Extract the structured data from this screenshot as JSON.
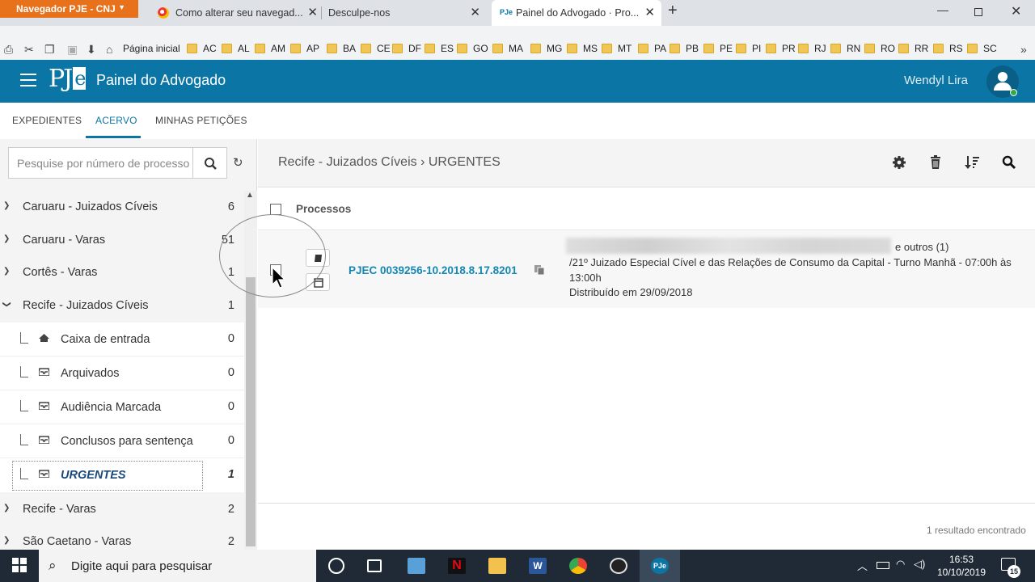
{
  "browser": {
    "app_menu": "Navegador PJE - CNJ",
    "tabs": [
      {
        "label": "Como alterar seu navegad..."
      },
      {
        "label": "Desculpe-nos"
      },
      {
        "label": "Painel do Advogado · Pro..."
      }
    ],
    "home_label": "Página inicial",
    "bookmarks": [
      "AC",
      "AL",
      "AM",
      "AP",
      "BA",
      "CE",
      "DF",
      "ES",
      "GO",
      "MA",
      "MG",
      "MS",
      "MT",
      "PA",
      "PB",
      "PE",
      "PI",
      "PR",
      "RJ",
      "RN",
      "RO",
      "RR",
      "RS",
      "SC"
    ]
  },
  "header": {
    "logo": "PJ",
    "logo_e": "e",
    "title": "Painel do Advogado",
    "user": "Wendyl Lira"
  },
  "nav": {
    "tabs": [
      "EXPEDIENTES",
      "ACERVO",
      "MINHAS PETIÇÕES"
    ],
    "active": "ACERVO"
  },
  "search": {
    "placeholder": "Pesquise por número de processo"
  },
  "tree": {
    "items": [
      {
        "label": "Caruaru - Juizados Cíveis",
        "count": "6"
      },
      {
        "label": "Caruaru - Varas",
        "count": "51"
      },
      {
        "label": "Cortês - Varas",
        "count": "1"
      },
      {
        "label": "Recife - Juizados Cíveis",
        "count": "1"
      },
      {
        "label": "Recife - Varas",
        "count": "2"
      },
      {
        "label": "São Caetano - Varas",
        "count": "2"
      }
    ],
    "subitems": [
      {
        "label": "Caixa de entrada",
        "count": "0"
      },
      {
        "label": "Arquivados",
        "count": "0"
      },
      {
        "label": "Audiência Marcada",
        "count": "0"
      },
      {
        "label": "Conclusos para sentença",
        "count": "0"
      },
      {
        "label": "URGENTES",
        "count": "1"
      }
    ]
  },
  "main": {
    "breadcrumb": "Recife - Juizados Cíveis › URGENTES",
    "list_header": "Processos",
    "process": {
      "number": "PJEC 0039256-10.2018.8.17.8201",
      "others": "e outros (1)",
      "court_line1": "/21º Juizado Especial Cível e das Relações de Consumo da Capital - Turno Manhã - 07:00h às",
      "court_line2": "13:00h",
      "distributed": "Distribuído em 29/09/2018"
    },
    "result_count": "1 resultado encontrado"
  },
  "taskbar": {
    "search_placeholder": "Digite aqui para pesquisar",
    "time": "16:53",
    "date": "10/10/2019",
    "notifications": "15"
  }
}
